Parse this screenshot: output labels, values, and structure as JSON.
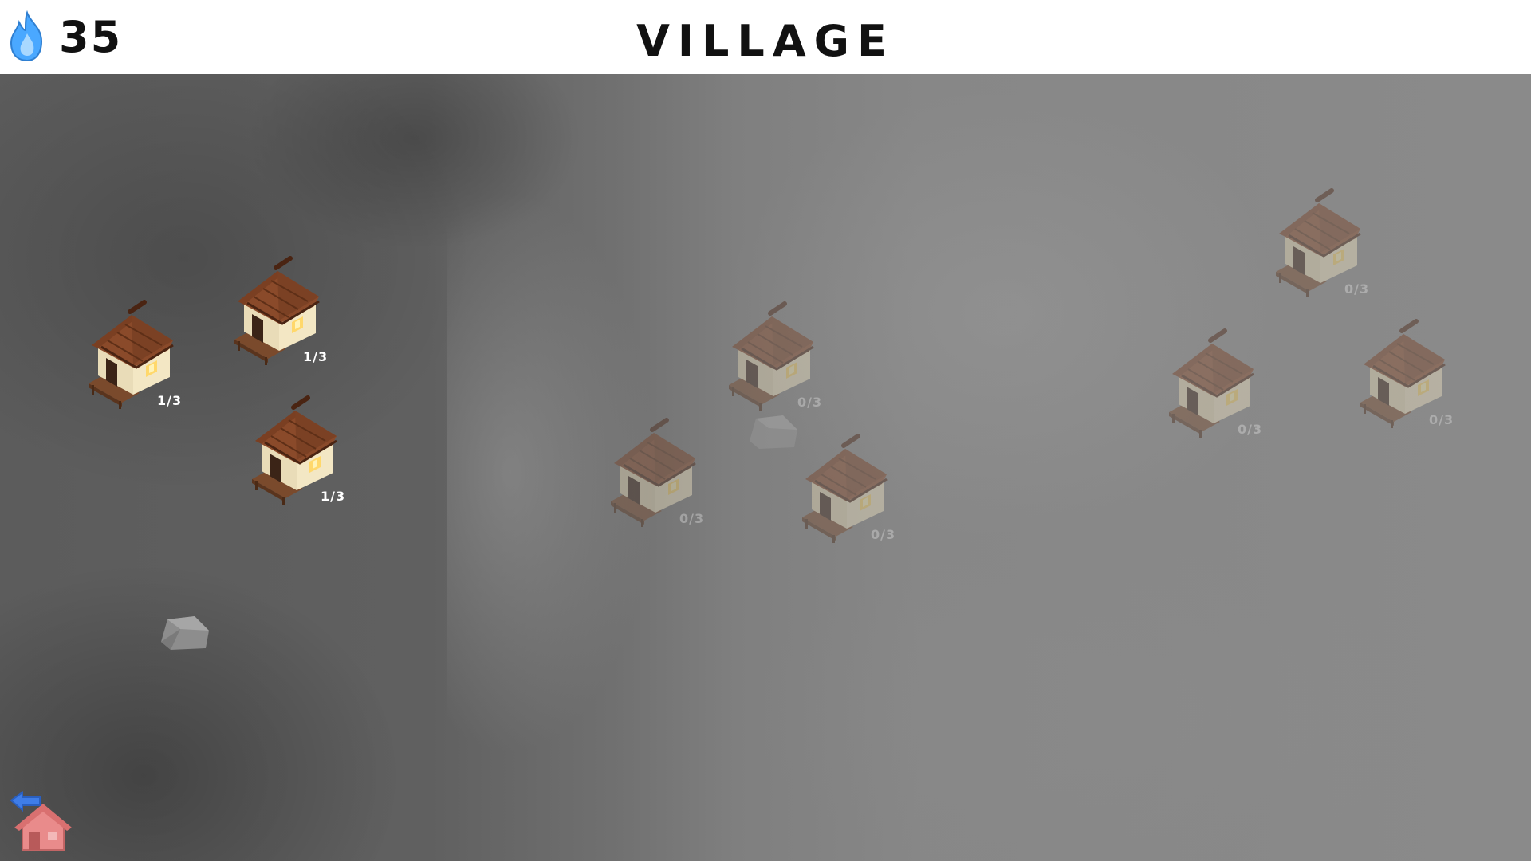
{
  "header": {
    "currency_icon": "blue-flame-icon",
    "currency_value": "35",
    "title": "VILLAGE"
  },
  "houses": [
    {
      "id": "house-1",
      "count": "1/3",
      "unlocked": true
    },
    {
      "id": "house-2",
      "count": "1/3",
      "unlocked": true
    },
    {
      "id": "house-3",
      "count": "1/3",
      "unlocked": true
    },
    {
      "id": "house-4",
      "count": "0/3",
      "unlocked": false
    },
    {
      "id": "house-5",
      "count": "0/3",
      "unlocked": false
    },
    {
      "id": "house-6",
      "count": "0/3",
      "unlocked": false
    },
    {
      "id": "house-7",
      "count": "0/3",
      "unlocked": false
    },
    {
      "id": "house-8",
      "count": "0/3",
      "unlocked": false
    },
    {
      "id": "house-9",
      "count": "0/3",
      "unlocked": false
    }
  ],
  "footer": {
    "home_button_icon": "back-home-icon"
  },
  "colors": {
    "flame": "#4aa8ff",
    "roof": "#6b3a22",
    "wall": "#efe3c2",
    "window_glow": "#ffd86b",
    "home_house": "#e98b8b",
    "back_arrow": "#3f7de8"
  }
}
